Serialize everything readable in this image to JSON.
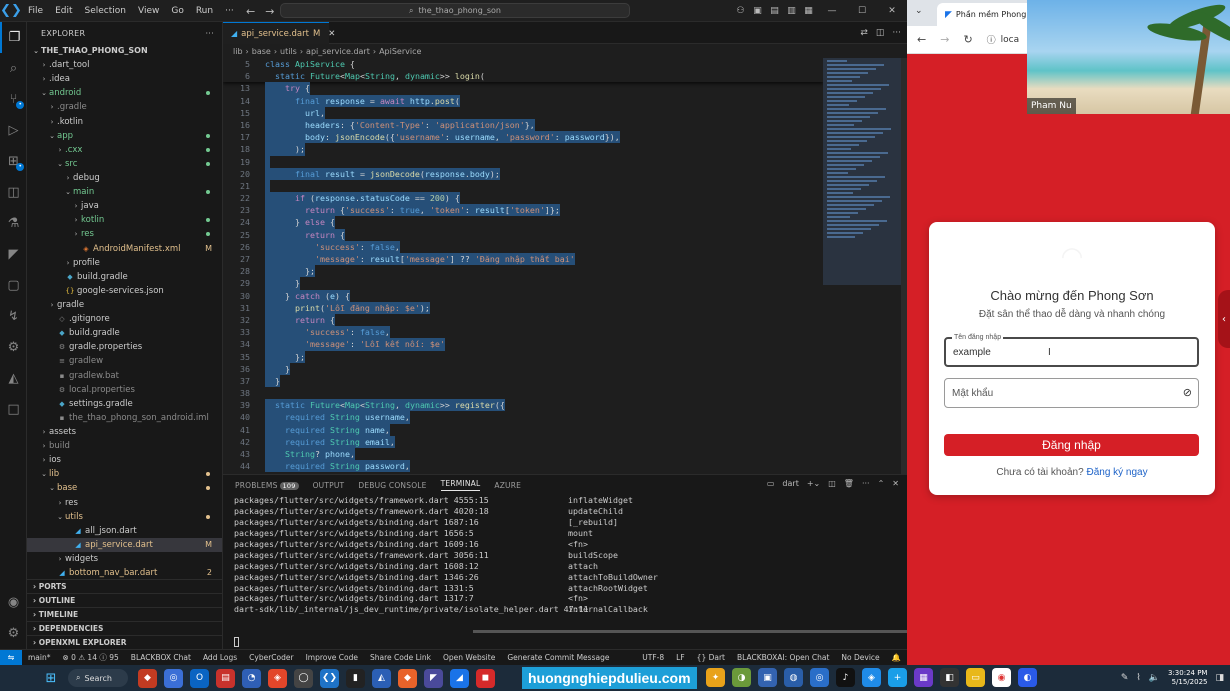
{
  "vscode": {
    "menu": [
      "File",
      "Edit",
      "Selection",
      "View",
      "Go",
      "Run",
      "···"
    ],
    "search_text": "the_thao_phong_son",
    "tab": {
      "name": "api_service.dart",
      "modified": "M"
    },
    "breadcrumb": [
      "lib",
      "base",
      "utils",
      "api_service.dart",
      "ApiService"
    ],
    "explorer_title": "EXPLORER",
    "root": "THE_THAO_PHONG_SON",
    "tree": [
      {
        "label": ".dart_tool",
        "depth": 1,
        "kind": "folder",
        "open": false,
        "color": "#cccccc"
      },
      {
        "label": ".idea",
        "depth": 1,
        "kind": "folder",
        "open": false,
        "color": "#cccccc"
      },
      {
        "label": "android",
        "depth": 1,
        "kind": "folder",
        "open": true,
        "color": "#73c991",
        "dot": true
      },
      {
        "label": ".gradle",
        "depth": 2,
        "kind": "folder",
        "open": false,
        "color": "#8b8b8b"
      },
      {
        "label": ".kotlin",
        "depth": 2,
        "kind": "folder",
        "open": false,
        "color": "#cccccc"
      },
      {
        "label": "app",
        "depth": 2,
        "kind": "folder",
        "open": true,
        "color": "#73c991",
        "dot": true
      },
      {
        "label": ".cxx",
        "depth": 3,
        "kind": "folder",
        "open": false,
        "color": "#73c991",
        "dot": true
      },
      {
        "label": "src",
        "depth": 3,
        "kind": "folder",
        "open": true,
        "color": "#73c991",
        "dot": true
      },
      {
        "label": "debug",
        "depth": 4,
        "kind": "folder",
        "open": false,
        "color": "#cccccc"
      },
      {
        "label": "main",
        "depth": 4,
        "kind": "folder",
        "open": true,
        "color": "#73c991",
        "dot": true
      },
      {
        "label": "java",
        "depth": 5,
        "kind": "folder",
        "open": false,
        "color": "#cccccc"
      },
      {
        "label": "kotlin",
        "depth": 5,
        "kind": "folder",
        "open": false,
        "color": "#73c991",
        "dot": true
      },
      {
        "label": "res",
        "depth": 5,
        "kind": "folder",
        "open": false,
        "color": "#73c991",
        "dot": true
      },
      {
        "label": "AndroidManifest.xml",
        "depth": 5,
        "kind": "file",
        "icon": "◈",
        "iconColor": "#e37933",
        "color": "#e2c08d",
        "badge": "M",
        "badgeColor": "#e2c08d"
      },
      {
        "label": "profile",
        "depth": 4,
        "kind": "folder",
        "open": false,
        "color": "#cccccc"
      },
      {
        "label": "build.gradle",
        "depth": 3,
        "kind": "file",
        "icon": "◆",
        "iconColor": "#4aa5c7",
        "color": "#cccccc"
      },
      {
        "label": "google-services.json",
        "depth": 3,
        "kind": "file",
        "icon": "{}",
        "iconColor": "#e8c040",
        "color": "#cccccc"
      },
      {
        "label": "gradle",
        "depth": 2,
        "kind": "folder",
        "open": false,
        "color": "#cccccc"
      },
      {
        "label": ".gitignore",
        "depth": 2,
        "kind": "file",
        "icon": "◇",
        "iconColor": "#8b8b8b",
        "color": "#cccccc"
      },
      {
        "label": "build.gradle",
        "depth": 2,
        "kind": "file",
        "icon": "◆",
        "iconColor": "#4aa5c7",
        "color": "#cccccc"
      },
      {
        "label": "gradle.properties",
        "depth": 2,
        "kind": "file",
        "icon": "⚙",
        "iconColor": "#8b8b8b",
        "color": "#cccccc"
      },
      {
        "label": "gradlew",
        "depth": 2,
        "kind": "file",
        "icon": "≡",
        "iconColor": "#8b8b8b",
        "color": "#8b8b8b"
      },
      {
        "label": "gradlew.bat",
        "depth": 2,
        "kind": "file",
        "icon": "▪",
        "iconColor": "#8b8b8b",
        "color": "#8b8b8b"
      },
      {
        "label": "local.properties",
        "depth": 2,
        "kind": "file",
        "icon": "⚙",
        "iconColor": "#8b8b8b",
        "color": "#8b8b8b"
      },
      {
        "label": "settings.gradle",
        "depth": 2,
        "kind": "file",
        "icon": "◆",
        "iconColor": "#4aa5c7",
        "color": "#cccccc"
      },
      {
        "label": "the_thao_phong_son_android.iml",
        "depth": 2,
        "kind": "file",
        "icon": "▪",
        "iconColor": "#8b8b8b",
        "color": "#8b8b8b"
      },
      {
        "label": "assets",
        "depth": 1,
        "kind": "folder",
        "open": false,
        "color": "#cccccc"
      },
      {
        "label": "build",
        "depth": 1,
        "kind": "folder",
        "open": false,
        "color": "#8b8b8b"
      },
      {
        "label": "ios",
        "depth": 1,
        "kind": "folder",
        "open": false,
        "color": "#cccccc"
      },
      {
        "label": "lib",
        "depth": 1,
        "kind": "folder",
        "open": true,
        "color": "#e2c08d",
        "dot": true,
        "dotColor": "#e2c08d"
      },
      {
        "label": "base",
        "depth": 2,
        "kind": "folder",
        "open": true,
        "color": "#e2c08d",
        "dot": true,
        "dotColor": "#e2c08d"
      },
      {
        "label": "res",
        "depth": 3,
        "kind": "folder",
        "open": false,
        "color": "#cccccc"
      },
      {
        "label": "utils",
        "depth": 3,
        "kind": "folder",
        "open": true,
        "color": "#e2c08d",
        "dot": true,
        "dotColor": "#e2c08d"
      },
      {
        "label": "all_json.dart",
        "depth": 4,
        "kind": "file",
        "icon": "◢",
        "iconColor": "#40b0f0",
        "color": "#cccccc"
      },
      {
        "label": "api_service.dart",
        "depth": 4,
        "kind": "file",
        "icon": "◢",
        "iconColor": "#40b0f0",
        "color": "#e2c08d",
        "badge": "M",
        "badgeColor": "#e2c08d",
        "selected": true
      },
      {
        "label": "widgets",
        "depth": 3,
        "kind": "folder",
        "open": false,
        "color": "#cccccc"
      },
      {
        "label": "bottom_nav_bar.dart",
        "depth": 2,
        "kind": "file",
        "icon": "◢",
        "iconColor": "#40b0f0",
        "color": "#e2c08d",
        "badge": "2",
        "badgeColor": "#e2c08d"
      }
    ],
    "sections": [
      "PORTS",
      "OUTLINE",
      "TIMELINE",
      "DEPENDENCIES",
      "OPENXML EXPLORER"
    ],
    "sticky_lines": [
      {
        "n": "5",
        "html": "<span class=\"kw\">class</span> <span class=\"ty\">ApiService</span> {"
      },
      {
        "n": "6",
        "html": "  <span class=\"kw\">static</span> <span class=\"ty\">Future</span>&lt;<span class=\"ty\">Map</span>&lt;<span class=\"ty\">String</span>, <span class=\"ty\">dynamic</span>&gt;&gt; <span class=\"fn\">login</span>("
      }
    ],
    "code_lines": [
      {
        "n": "13",
        "sel": true,
        "html": "    <span class=\"kw2\">try</span> {"
      },
      {
        "n": "14",
        "sel": true,
        "html": "      <span class=\"kw\">final</span> <span class=\"vr\">response</span> = <span class=\"kw2\">await</span> <span class=\"vr\">http</span>.<span class=\"fn\">post</span>("
      },
      {
        "n": "15",
        "sel": true,
        "html": "        <span class=\"vr\">url</span>,"
      },
      {
        "n": "16",
        "sel": true,
        "html": "        <span class=\"vr\">headers</span>: {<span class=\"st\">'Content-Type'</span>: <span class=\"st\">'application/json'</span>},"
      },
      {
        "n": "17",
        "sel": true,
        "html": "        <span class=\"vr\">body</span>: <span class=\"fn\">jsonEncode</span>({<span class=\"st\">'username'</span>: <span class=\"vr\">username</span>, <span class=\"st\">'password'</span>: <span class=\"vr\">password</span>}),"
      },
      {
        "n": "18",
        "sel": true,
        "html": "      );"
      },
      {
        "n": "19",
        "sel": true,
        "html": ""
      },
      {
        "n": "20",
        "sel": true,
        "html": "      <span class=\"kw\">final</span> <span class=\"vr\">result</span> = <span class=\"fn\">jsonDecode</span>(<span class=\"vr\">response</span>.<span class=\"vr\">body</span>);"
      },
      {
        "n": "21",
        "sel": true,
        "html": ""
      },
      {
        "n": "22",
        "sel": true,
        "html": "      <span class=\"kw2\">if</span> (<span class=\"vr\">response</span>.<span class=\"vr\">statusCode</span> == <span class=\"nm\">200</span>) {"
      },
      {
        "n": "23",
        "sel": true,
        "html": "        <span class=\"kw2\">return</span> {<span class=\"st\">'success'</span>: <span class=\"kw\">true</span>, <span class=\"st\">'token'</span>: <span class=\"vr\">result</span>[<span class=\"st\">'token'</span>]};"
      },
      {
        "n": "24",
        "sel": true,
        "html": "      } <span class=\"kw2\">else</span> {"
      },
      {
        "n": "25",
        "sel": true,
        "html": "        <span class=\"kw2\">return</span> {"
      },
      {
        "n": "26",
        "sel": true,
        "html": "          <span class=\"st\">'success'</span>: <span class=\"kw\">false</span>,"
      },
      {
        "n": "27",
        "sel": true,
        "html": "          <span class=\"st\">'message'</span>: <span class=\"vr\">result</span>[<span class=\"st\">'message'</span>] ?? <span class=\"st\">'Đăng nhập thất bại'</span>"
      },
      {
        "n": "28",
        "sel": true,
        "html": "        };"
      },
      {
        "n": "29",
        "sel": true,
        "html": "      }"
      },
      {
        "n": "30",
        "sel": true,
        "html": "    } <span class=\"kw2\">catch</span> (<span class=\"vr\">e</span>) {"
      },
      {
        "n": "31",
        "sel": true,
        "html": "      <span class=\"fn\">print</span>(<span class=\"st\">'Lỗi đăng nhập: $e'</span>);"
      },
      {
        "n": "32",
        "sel": true,
        "html": "      <span class=\"kw2\">return</span> {"
      },
      {
        "n": "33",
        "sel": true,
        "html": "        <span class=\"st\">'success'</span>: <span class=\"kw\">false</span>,"
      },
      {
        "n": "34",
        "sel": true,
        "html": "        <span class=\"st\">'message'</span>: <span class=\"st\">'Lỗi kết nối: $e'</span>"
      },
      {
        "n": "35",
        "sel": true,
        "html": "      };"
      },
      {
        "n": "36",
        "sel": true,
        "html": "    }"
      },
      {
        "n": "37",
        "sel": true,
        "html": "  }"
      },
      {
        "n": "38",
        "sel": false,
        "html": ""
      },
      {
        "n": "39",
        "sel": true,
        "html": "  <span class=\"kw\">static</span> <span class=\"ty\">Future</span>&lt;<span class=\"ty\">Map</span>&lt;<span class=\"ty\">String</span>, <span class=\"ty\">dynamic</span>&gt;&gt; <span class=\"fn\">register</span>({"
      },
      {
        "n": "40",
        "sel": true,
        "html": "    <span class=\"kw\">required</span> <span class=\"ty\">String</span> <span class=\"vr\">username</span>,"
      },
      {
        "n": "41",
        "sel": true,
        "html": "    <span class=\"kw\">required</span> <span class=\"ty\">String</span> <span class=\"vr\">name</span>,"
      },
      {
        "n": "42",
        "sel": true,
        "html": "    <span class=\"kw\">required</span> <span class=\"ty\">String</span> <span class=\"vr\">email</span>,"
      },
      {
        "n": "43",
        "sel": true,
        "html": "    <span class=\"ty\">String</span>? <span class=\"vr\">phone</span>,"
      },
      {
        "n": "44",
        "sel": true,
        "html": "    <span class=\"kw\">required</span> <span class=\"ty\">String</span> <span class=\"vr\">password</span>,"
      }
    ],
    "panel_tabs": [
      {
        "label": "PROBLEMS",
        "badge": "109"
      },
      {
        "label": "OUTPUT"
      },
      {
        "label": "DEBUG CONSOLE"
      },
      {
        "label": "TERMINAL",
        "active": true
      },
      {
        "label": "AZURE"
      }
    ],
    "terminal_kind": "dart",
    "terminal": [
      [
        "packages/flutter/src/widgets/framework.dart 4555:15",
        "inflateWidget"
      ],
      [
        "packages/flutter/src/widgets/framework.dart 4020:18",
        "updateChild"
      ],
      [
        "packages/flutter/src/widgets/binding.dart 1687:16",
        "[_rebuild]"
      ],
      [
        "packages/flutter/src/widgets/binding.dart 1656:5",
        "mount"
      ],
      [
        "packages/flutter/src/widgets/binding.dart 1609:16",
        "<fn>"
      ],
      [
        "packages/flutter/src/widgets/framework.dart 3056:11",
        "buildScope"
      ],
      [
        "packages/flutter/src/widgets/binding.dart 1608:12",
        "attach"
      ],
      [
        "packages/flutter/src/widgets/binding.dart 1346:26",
        "attachToBuildOwner"
      ],
      [
        "packages/flutter/src/widgets/binding.dart 1331:5",
        "attachRootWidget"
      ],
      [
        "packages/flutter/src/widgets/binding.dart 1317:7",
        "<fn>"
      ],
      [
        "dart-sdk/lib/_internal/js_dev_runtime/private/isolate_helper.dart 47:11",
        "internalCallback"
      ]
    ],
    "status_left": [
      "main*",
      "⊗ 0 ⚠ 14 ⓘ 95",
      "BLACKBOX Chat",
      "Add Logs",
      "CyberCoder",
      "Improve Code",
      "Share Code Link",
      "Open Website",
      "Generate Commit Message"
    ],
    "status_right": [
      "UTF-8",
      "LF",
      "{} Dart",
      "BLACKBOXAI: Open Chat",
      "No Device"
    ]
  },
  "browser": {
    "tab_title": "Phần mềm Phong Sơn",
    "url": "loca",
    "participant": "Pham Nu",
    "login": {
      "title": "Chào mừng đến Phong Sơn",
      "subtitle": "Đặt sân thể thao dễ dàng và nhanh chóng",
      "username_label": "Tên đăng nhập",
      "username_value": "example",
      "password_placeholder": "Mật khẩu",
      "button": "Đăng nhập",
      "register_prompt": "Chưa có tài khoản?",
      "register_link": "Đăng ký ngay"
    }
  },
  "taskbar": {
    "search": "Search",
    "watermark": "huongnghiepdulieu.com",
    "time": "3:30:24 PM",
    "date": "5/15/2025"
  },
  "colors": {
    "accent": "#0078d4",
    "app_red": "#d51f26"
  }
}
